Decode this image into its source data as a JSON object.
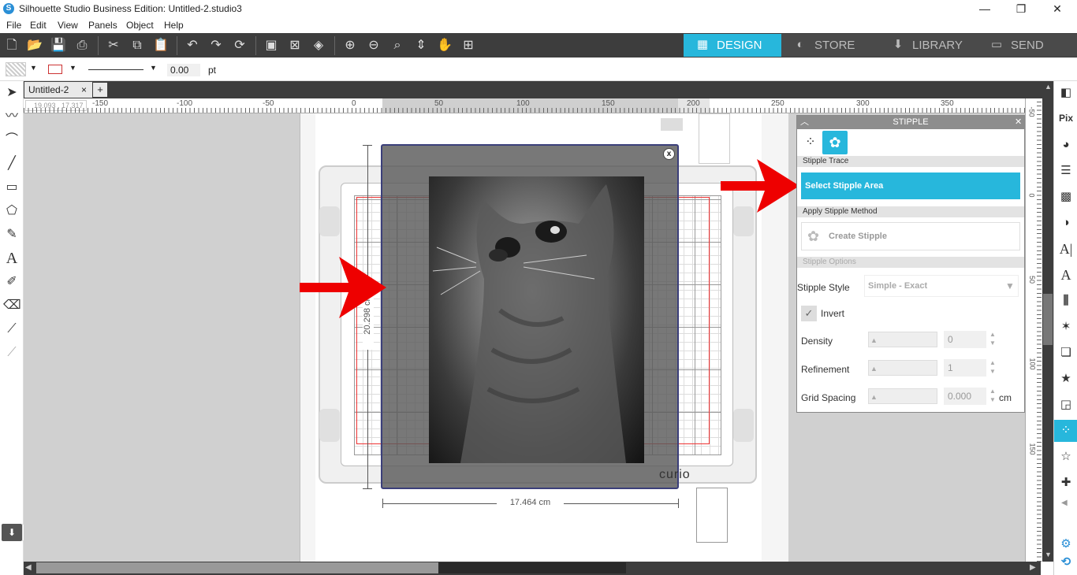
{
  "window": {
    "title": "Silhouette Studio Business Edition: Untitled-2.studio3",
    "minimize": "—",
    "maximize": "❐",
    "close": "✕"
  },
  "menu": [
    "File",
    "Edit",
    "View",
    "Panels",
    "Object",
    "Help"
  ],
  "tabs": {
    "design": "DESIGN",
    "store": "STORE",
    "library": "LIBRARY",
    "send": "SEND"
  },
  "propbar": {
    "line_width": "0.00",
    "unit": "pt"
  },
  "doc_tab": {
    "name": "Untitled-2",
    "close": "×",
    "add": "+"
  },
  "ruler": {
    "coords": "19.093 , 17.317",
    "top_ticks": [
      "-150",
      "-100",
      "-50",
      "0",
      "50",
      "100",
      "150",
      "200",
      "250",
      "300",
      "350"
    ],
    "right_ticks": [
      "-50",
      "0",
      "50",
      "100",
      "150"
    ]
  },
  "canvas": {
    "height_dim": "20.298 cm",
    "width_dim": "17.464 cm",
    "mat_brand": "curio",
    "close_x": "x"
  },
  "stipple": {
    "title": "STIPPLE",
    "section_trace": "Stipple Trace",
    "select_button": "Select Stipple Area",
    "section_method": "Apply Stipple Method",
    "create_button": "Create Stipple",
    "section_options": "Stipple Options",
    "style_label": "Stipple Style",
    "style_value": "Simple - Exact",
    "invert_label": "Invert",
    "invert_checked": true,
    "density_label": "Density",
    "density_value": "0",
    "refinement_label": "Refinement",
    "refinement_value": "1",
    "grid_label": "Grid Spacing",
    "grid_value": "0.000",
    "grid_unit": "cm"
  },
  "colors": {
    "accent": "#27b7dc",
    "toolbar": "#3d3d3d",
    "arrow": "#ee0000"
  }
}
